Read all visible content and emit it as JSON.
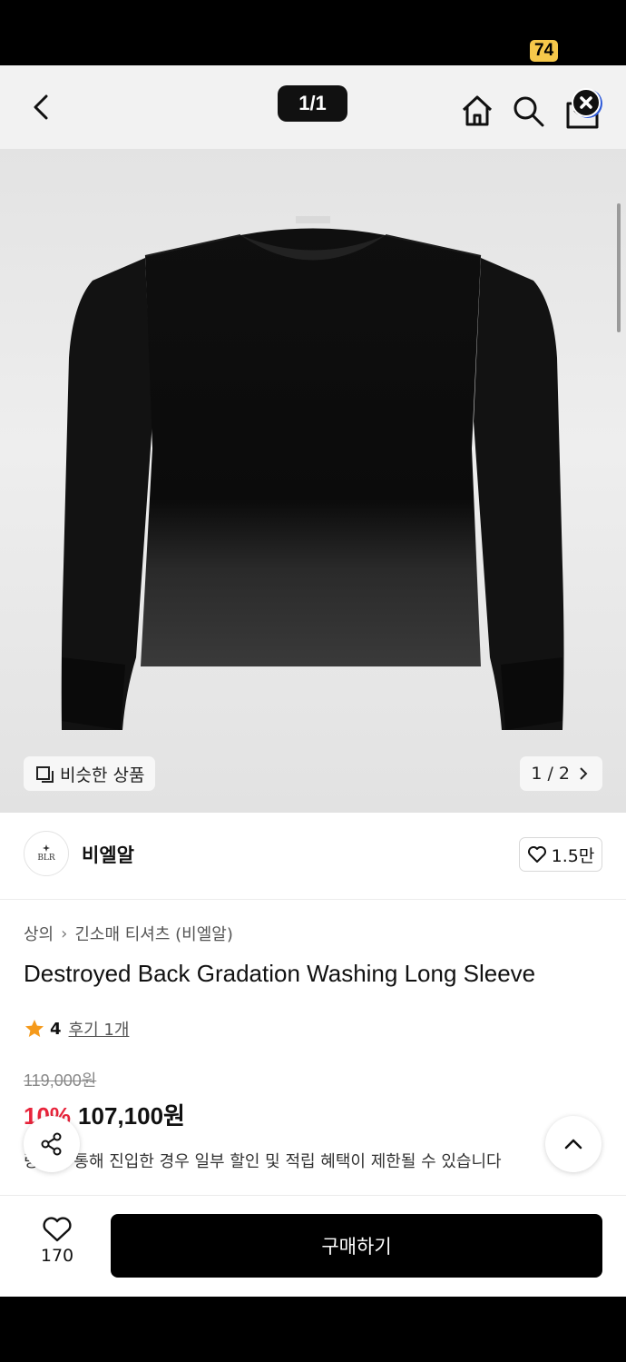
{
  "status_bar": {
    "battery": "74",
    "battery_color": "#f6c84a"
  },
  "header": {
    "page_indicator": "1/1",
    "icons": [
      "back-arrow-icon",
      "home-icon",
      "search-icon",
      "shopping-bag-icon",
      "close-icon"
    ]
  },
  "hero": {
    "image": "black-long-sleeve-tshirt",
    "similar_label": "비슷한 상품",
    "image_counter": "1 / 2"
  },
  "brand": {
    "logo_text": "BLR",
    "name": "비엘알",
    "likes": "1.5만"
  },
  "product": {
    "breadcrumb": [
      "상의",
      "긴소매 티셔츠 (비엘알)"
    ],
    "title": "Destroyed Back Gradation Washing Long Sleeve",
    "rating": "4",
    "review_link": "후기 1개",
    "original_price": "119,000원",
    "discount": "10%",
    "price": "107,100원",
    "notice": "링크를 통해 진입한 경우 일부 할인 및 적립 혜택이 제한될 수 있습니다"
  },
  "colors": {
    "discount": "#e8243b",
    "star": "#f59a1b",
    "buy_button": "#000000"
  },
  "bottom_bar": {
    "wish_count": "170",
    "buy_label": "구매하기"
  }
}
